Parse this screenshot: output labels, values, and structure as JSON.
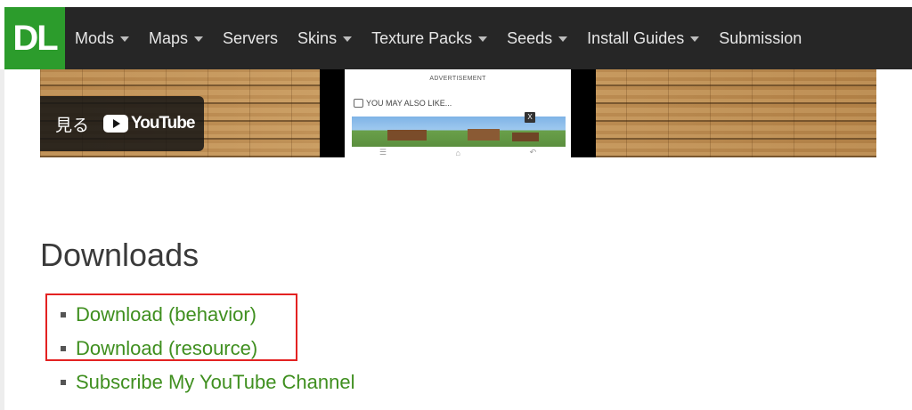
{
  "navbar": {
    "logo": "DL",
    "items": [
      {
        "label": "Mods",
        "dropdown": true
      },
      {
        "label": "Maps",
        "dropdown": true
      },
      {
        "label": "Servers",
        "dropdown": false
      },
      {
        "label": "Skins",
        "dropdown": true
      },
      {
        "label": "Texture Packs",
        "dropdown": true
      },
      {
        "label": "Seeds",
        "dropdown": true
      },
      {
        "label": "Install Guides",
        "dropdown": true
      },
      {
        "label": "Submission",
        "dropdown": false
      }
    ]
  },
  "video": {
    "watch_label": "見る",
    "youtube_label": "YouTube",
    "ad_label": "ADVERTISEMENT",
    "may_like": "YOU MAY ALSO LIKE...",
    "close_label": "X"
  },
  "downloads": {
    "title": "Downloads",
    "links": [
      {
        "label": "Download (behavior)"
      },
      {
        "label": "Download (resource)"
      },
      {
        "label": "Subscribe My YouTube Channel"
      }
    ]
  },
  "colors": {
    "navbar_bg": "#262626",
    "logo_bg": "#2c9c2c",
    "link": "#3f8f1f",
    "highlight": "#e32222"
  }
}
